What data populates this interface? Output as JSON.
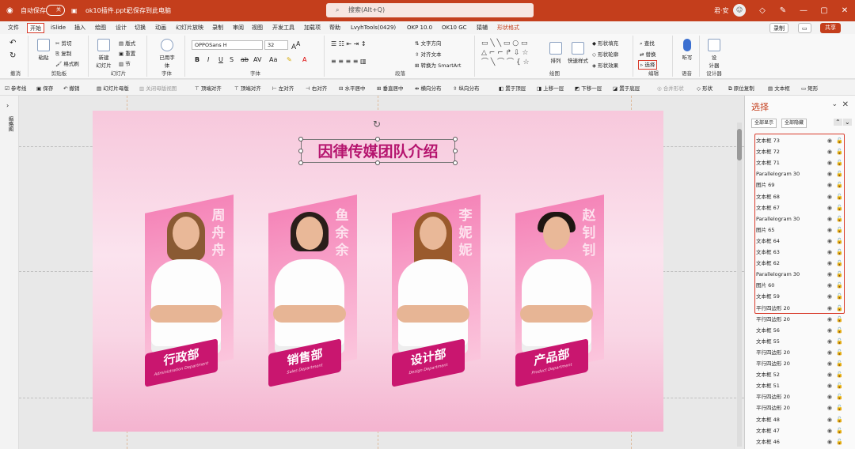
{
  "titlebar": {
    "autosave": "自动保存",
    "toggle": "关",
    "filename": "ok10插件.pptx",
    "saved": "已保存到此电脑",
    "search": "搜索(Alt+Q)",
    "user": "君·安"
  },
  "tabs": [
    "文件",
    "开始",
    "iSlide",
    "插入",
    "绘图",
    "设计",
    "切换",
    "动画",
    "幻灯片放映",
    "录制",
    "审阅",
    "视图",
    "开发工具",
    "加载项",
    "帮助",
    "LvyhTools(0429)",
    "OKP 10.0",
    "OK10 GC",
    "猿辅",
    "形状格式"
  ],
  "tab_active": "开始",
  "tab_record": "录制",
  "tab_share": "共享",
  "ribbon": {
    "undo": "撤消",
    "clipboard": "剪贴板",
    "paste": "粘贴",
    "cut": "剪切",
    "copy": "复制",
    "format_painter": "格式刷",
    "slides": "幻灯片",
    "new_slide": "新建\n幻灯片",
    "layout": "版式",
    "reset": "重置",
    "section": "节",
    "reuse": "已用字\n体",
    "font_group": "字体",
    "font_name": "OPPOSans H",
    "font_size": "32",
    "para_group": "段落",
    "text_dir": "文字方向",
    "align_text": "对齐文本",
    "smartart": "转换为 SmartArt",
    "drawing": "绘图",
    "arrange": "排列",
    "quick_styles": "快速样式",
    "shape_fill": "形状填充",
    "shape_outline": "形状轮廓",
    "shape_effect": "形状效果",
    "edit_group": "编辑",
    "find": "查找",
    "replace": "替换",
    "select": "选择",
    "voice": "语音",
    "dictate": "听写",
    "designer": "设计器",
    "designer_btn": "设\n计器"
  },
  "qat": [
    "参考线",
    "保存",
    "撤销",
    "幻灯片母版",
    "关闭母版视图",
    "顶端对齐",
    "顶端对齐",
    "左对齐",
    "右对齐",
    "水平居中",
    "垂直居中",
    "横向分布",
    "纵向分布",
    "置于顶层",
    "上移一层",
    "下移一层",
    "置于底层",
    "合并形状",
    "形状",
    "原位复制",
    "文本框",
    "矩形"
  ],
  "left_label": "缩略图",
  "slide": {
    "title": "因律传媒团队介绍"
  },
  "cards": [
    {
      "name": "周舟舟",
      "dept": "行政部",
      "en": "Administration Department"
    },
    {
      "name": "鱼余余",
      "dept": "销售部",
      "en": "Sales Department"
    },
    {
      "name": "李妮妮",
      "dept": "设计部",
      "en": "Design Department"
    },
    {
      "name": "赵钊钊",
      "dept": "产品部",
      "en": "Product Department"
    }
  ],
  "pane": {
    "title": "选择",
    "show_all": "全部显示",
    "hide_all": "全部隐藏",
    "items": [
      "文本框 73",
      "文本框 72",
      "文本框 71",
      "Parallelogram 30",
      "图片 69",
      "文本框 68",
      "文本框 67",
      "Parallelogram 30",
      "图片 65",
      "文本框 64",
      "文本框 63",
      "文本框 62",
      "Parallelogram 30",
      "图片 60",
      "文本框 59",
      "平行四边形 20",
      "平行四边形 20",
      "文本框 56",
      "文本框 55",
      "平行四边形 20",
      "平行四边形 20",
      "文本框 52",
      "文本框 51",
      "平行四边形 20",
      "平行四边形 20",
      "文本框 48",
      "文本框 47",
      "文本框 46"
    ]
  },
  "colors": {
    "accent": "#c43e1c",
    "title": "#b5146e",
    "dept": "#c9166f",
    "highlight": "#d83b2b"
  }
}
